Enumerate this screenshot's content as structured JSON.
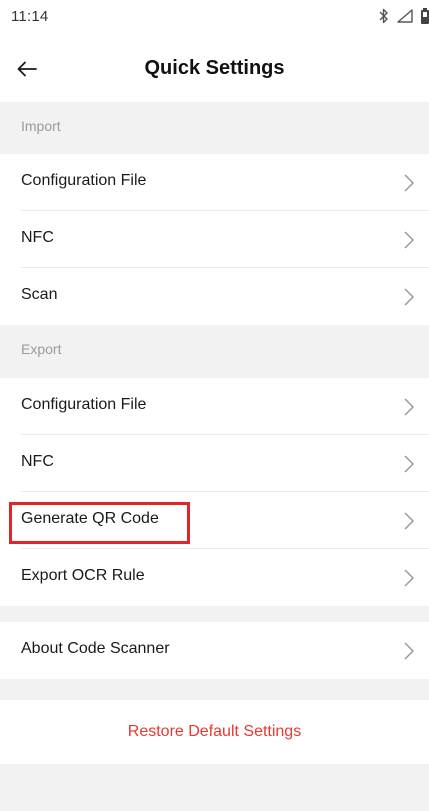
{
  "status_bar": {
    "time": "11:14",
    "icons": [
      "bluetooth-icon",
      "signal-icon",
      "battery-icon"
    ]
  },
  "header": {
    "back_icon": "back-arrow-icon",
    "title": "Quick Settings"
  },
  "sections": {
    "import": {
      "title": "Import",
      "items": [
        {
          "label": "Configuration File"
        },
        {
          "label": "NFC"
        },
        {
          "label": "Scan"
        }
      ]
    },
    "export": {
      "title": "Export",
      "items": [
        {
          "label": "Configuration File"
        },
        {
          "label": "NFC"
        },
        {
          "label": "Generate QR Code"
        },
        {
          "label": "Export OCR Rule"
        }
      ]
    },
    "about": {
      "items": [
        {
          "label": "About Code Scanner"
        }
      ]
    }
  },
  "restore": {
    "label": "Restore Default Settings"
  },
  "colors": {
    "background": "#f2f2f2",
    "surface": "#ffffff",
    "restore_text": "#e8392f",
    "highlight": "#e0262b",
    "section_text": "#9a9a9a"
  }
}
